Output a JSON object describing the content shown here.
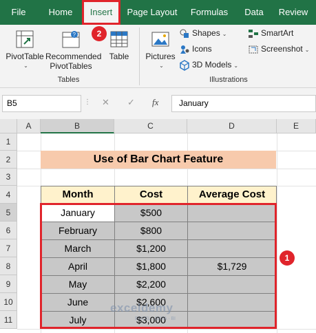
{
  "tabs": [
    "File",
    "Home",
    "Insert",
    "Page Layout",
    "Formulas",
    "Data",
    "Review"
  ],
  "ribbon": {
    "pivottable": "PivotTable",
    "pivottable_caret": "⌄",
    "recommended_line1": "Recommended",
    "recommended_line2": "PivotTables",
    "table": "Table",
    "tables_group": "Tables",
    "pictures": "Pictures",
    "pictures_caret": "⌄",
    "shapes": "Shapes",
    "icons": "Icons",
    "models": "3D Models",
    "smartart": "SmartArt",
    "screenshot": "Screenshot",
    "illustrations_group": "Illustrations"
  },
  "formula_bar": {
    "name_box": "B5",
    "fx": "fx",
    "value": "January"
  },
  "columns": [
    "A",
    "B",
    "C",
    "D",
    "E"
  ],
  "rows": [
    "1",
    "2",
    "3",
    "4",
    "5",
    "6",
    "7",
    "8",
    "9",
    "10",
    "11"
  ],
  "sheet": {
    "title": "Use of Bar Chart Feature",
    "headers": [
      "Month",
      "Cost",
      "Average Cost"
    ],
    "data": [
      [
        "January",
        "$500",
        ""
      ],
      [
        "February",
        "$800",
        ""
      ],
      [
        "March",
        "$1,200",
        ""
      ],
      [
        "April",
        "$1,800",
        "$1,729"
      ],
      [
        "May",
        "$2,200",
        ""
      ],
      [
        "June",
        "$2,600",
        ""
      ],
      [
        "July",
        "$3,000",
        ""
      ]
    ]
  },
  "badges": {
    "insert_step": "2",
    "range_step": "1"
  },
  "watermark": {
    "brand": "exceldemy",
    "sub": "EXCEL · DATA · BI"
  },
  "colors": {
    "excel_green": "#217346",
    "highlight_red": "#e0242b",
    "title_fill": "#f7caac",
    "header_fill": "#fff2cc",
    "data_fill": "#c8c8c8"
  }
}
